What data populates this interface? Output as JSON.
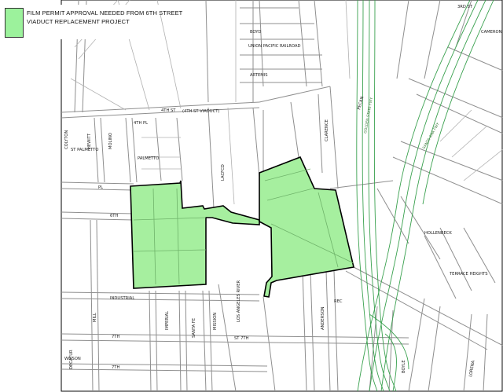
{
  "legend": {
    "line1": "FILM PERMIT APPROVAL NEEDED FROM 6TH STREET",
    "line2": "VIADUCT REPLACEMENT PROJECT",
    "swatch_color": "#9cf29c"
  },
  "colors": {
    "permit_area": "#a6ef9f",
    "freeway": "#3aa14f",
    "streets": "#8f8f8f"
  },
  "labels": {
    "fourth_st": "4TH ST",
    "fourth_viaduct": "(4TH ST VIADUCT)",
    "fourth_pl": "4TH PL",
    "palmetto": "PALMETTO",
    "st_palmetto": "ST PALMETTO",
    "sixth_st": "6TH",
    "sixth_pl": "PL",
    "industrial_st": "INDUSTRIAL",
    "seventh_st": "7TH",
    "seventh_st_b": "ST 7TH",
    "seventh_pl": "7TH",
    "wilson": "WILSON",
    "decatur": "DECATUR",
    "mill": "MILL",
    "imperial": "IMPERIAL",
    "santa_fe": "SANTA FE",
    "mission": "MISSION",
    "lacfcd": "LACFCD",
    "la_river": "LOS ANGELES RIVER",
    "union_pacific": "UNION PACIFIC RAILROAD",
    "artemis": "ARTEMIS",
    "boyd": "BOYD",
    "anderson": "ANDERSON",
    "clarence": "CLARENCE",
    "boyle": "BOYLE",
    "hollenbeck": "HOLLENBECK",
    "pecan": "PECAN",
    "lorena": "LORENA",
    "golden_state": "GOLDEN STATE FWY",
    "santa_ana": "SANTA ANA FWY",
    "third_st": "3RD ST",
    "colyton": "COLYTON",
    "hewitt": "HEWITT",
    "molino": "MOLINO",
    "terrace_heights": "TERRACE HEIGHTS",
    "rec": "REC",
    "cameron": "CAMERON"
  }
}
